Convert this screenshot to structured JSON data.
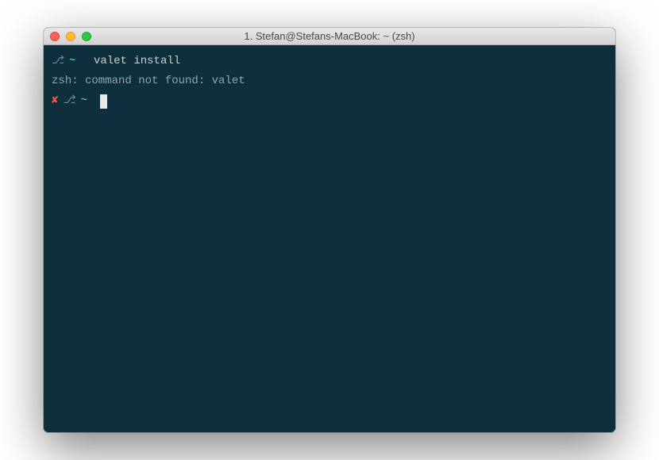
{
  "window": {
    "title": "1. Stefan@Stefans-MacBook: ~ (zsh)"
  },
  "terminal": {
    "line1": {
      "git_symbol": "⎇",
      "path": "~",
      "command": " valet install"
    },
    "line2": {
      "output": "zsh: command not found: valet"
    },
    "line3": {
      "error_symbol": "✘",
      "git_symbol": "⎇",
      "path": "~"
    }
  }
}
